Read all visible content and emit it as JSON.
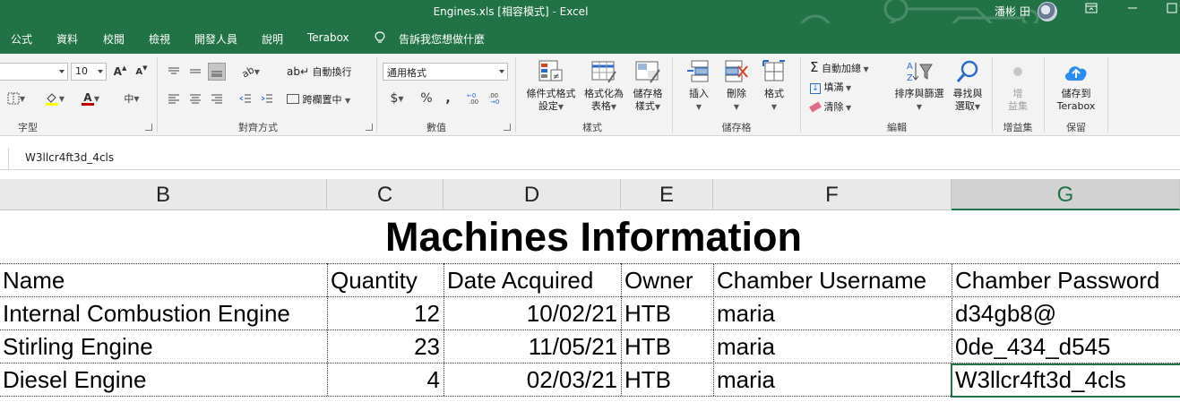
{
  "window": {
    "title": "Engines.xls [相容模式] - Excel",
    "user_name": "潘彬 田"
  },
  "menu": {
    "tabs": [
      "公式",
      "資料",
      "校閱",
      "檢視",
      "開發人員",
      "說明",
      "Terabox"
    ],
    "tell_me": "告訴我您想做什麼"
  },
  "ribbon": {
    "font": {
      "size": "10",
      "grow_label": "A",
      "shrink_label": "A",
      "color_label": "A",
      "group_label": "字型"
    },
    "alignment": {
      "wrap_text": "自動換行",
      "merge_center": "跨欄置中",
      "group_label": "對齊方式"
    },
    "number": {
      "format": "通用格式",
      "currency": "$",
      "percent": "%",
      "comma": ",",
      "group_label": "數值"
    },
    "styles": {
      "conditional": [
        "條件式格式",
        "設定"
      ],
      "format_table": [
        "格式化為",
        "表格"
      ],
      "cell_styles": [
        "儲存格",
        "樣式"
      ],
      "group_label": "樣式"
    },
    "cells": {
      "insert": "插入",
      "delete": "刪除",
      "format": "格式",
      "group_label": "儲存格"
    },
    "editing": {
      "autosum": "自動加總",
      "fill": "填滿",
      "clear": "清除",
      "sort_filter": "排序與篩選",
      "find_select": [
        "尋找與",
        "選取"
      ],
      "group_label": "編輯"
    },
    "addins": {
      "label": [
        "增",
        "益集"
      ],
      "group_label": "增益集"
    },
    "terabox": {
      "label": [
        "儲存到",
        "Terabox"
      ],
      "group_label": "保留"
    }
  },
  "formula_bar": {
    "value": "W3llcr4ft3d_4cls"
  },
  "columns": [
    "B",
    "C",
    "D",
    "E",
    "F",
    "G"
  ],
  "active_column": "G",
  "sheet": {
    "title": "Machines Information",
    "headers": [
      "Name",
      "Quantity",
      "Date Acquired",
      "Owner",
      "Chamber Username",
      "Chamber Password"
    ],
    "rows": [
      [
        "Internal Combustion Engine",
        "12",
        "10/02/21",
        "HTB",
        "maria",
        "d34gb8@"
      ],
      [
        "Stirling Engine",
        "23",
        "11/05/21",
        "HTB",
        "maria",
        "0de_434_d545"
      ],
      [
        "Diesel Engine",
        "4",
        "02/03/21",
        "HTB",
        "maria",
        "W3llcr4ft3d_4cls"
      ]
    ]
  },
  "colors": {
    "excel_green": "#217346",
    "ribbon_bg": "#f3f3f3"
  }
}
